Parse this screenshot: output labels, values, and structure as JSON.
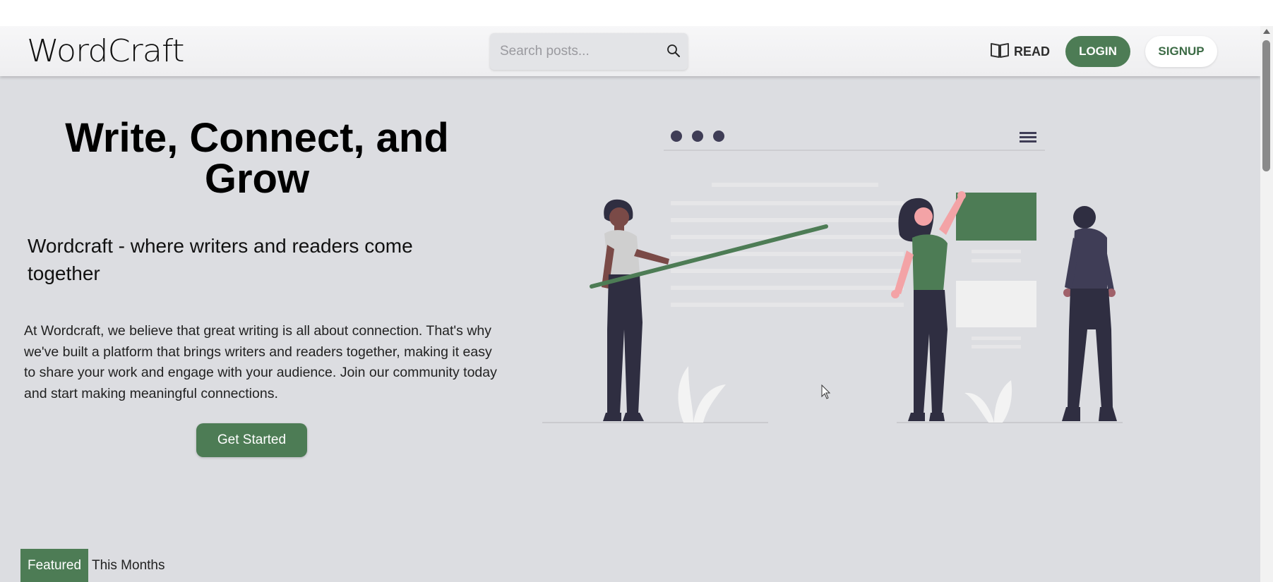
{
  "navbar": {
    "logo": "WordCraft",
    "search_placeholder": "Search posts...",
    "read_label": "READ",
    "login_label": "LOGIN",
    "signup_label": "SIGNUP"
  },
  "hero": {
    "title": "Write, Connect, and Grow",
    "subtitle": "Wordcraft - where writers and readers come together",
    "description": "At Wordcraft, we believe that great writing is all about connection. That's why we've built a platform that brings writers and readers together, making it easy to share your work and engage with your audience. Join our community today and start making meaningful connections.",
    "cta_label": "Get Started"
  },
  "tabs": {
    "featured_label": "Featured",
    "month_label": "This Months"
  },
  "icons": {
    "search": "search-icon",
    "read": "book-icon",
    "menu": "hamburger-menu-icon"
  },
  "colors": {
    "accent": "#4d7c55",
    "background": "#dcdde1",
    "navbar": "#f3f3f4"
  }
}
